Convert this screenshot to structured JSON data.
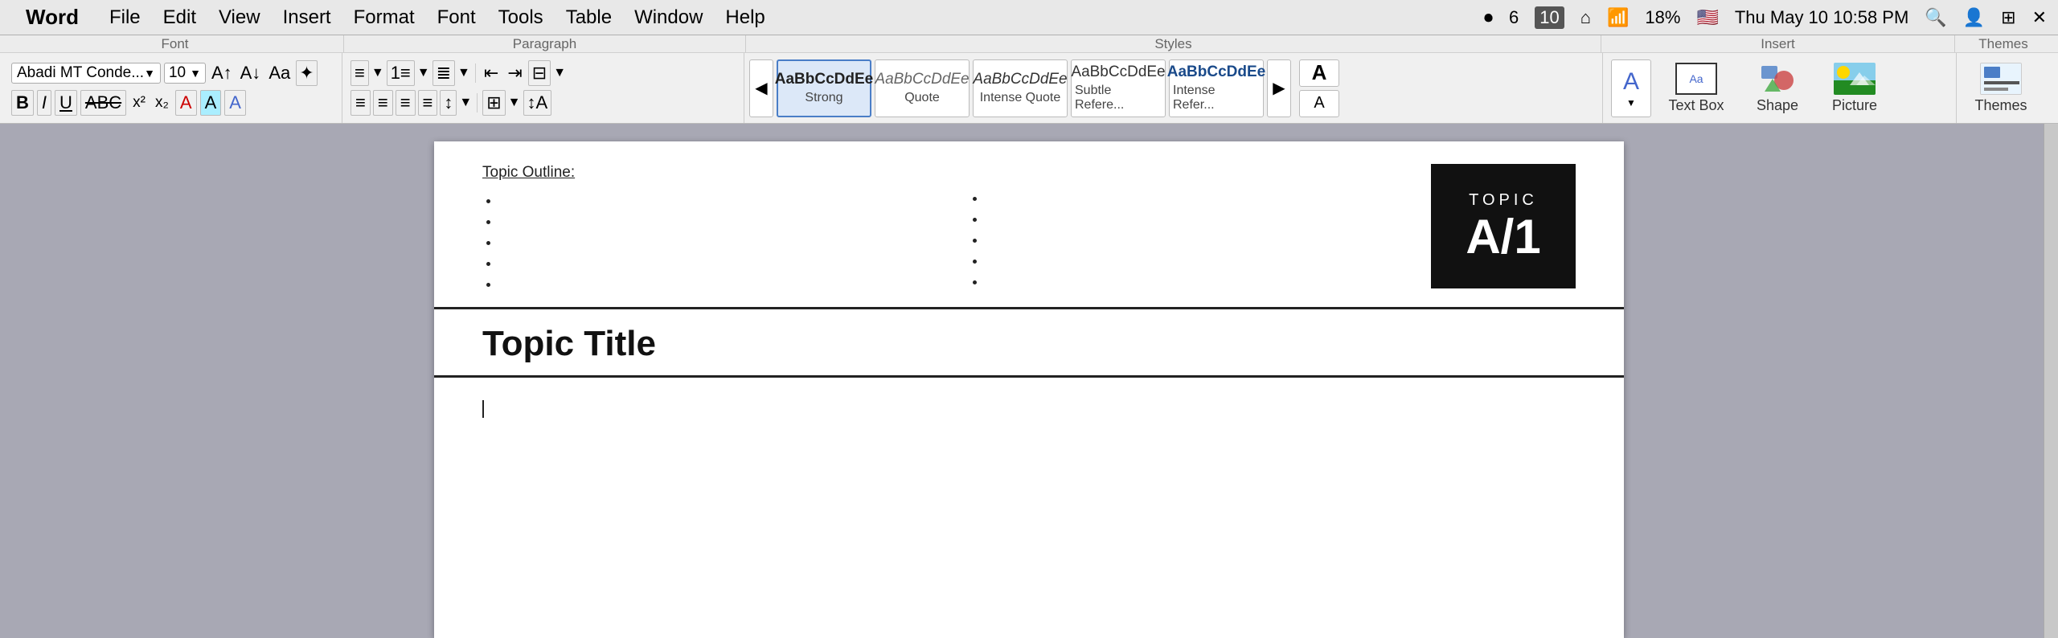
{
  "app": {
    "name": "Word",
    "apple_logo": ""
  },
  "menu_bar": {
    "items": [
      "File",
      "Edit",
      "View",
      "Insert",
      "Format",
      "Font",
      "Tools",
      "Table",
      "Window",
      "Help"
    ],
    "status": {
      "battery": "18%",
      "time": "Thu May 10  10:58 PM",
      "wifi": "WiFi",
      "bluetooth": "BT"
    }
  },
  "toolbar": {
    "section_labels": [
      "Font",
      "Paragraph",
      "Styles",
      "Insert",
      "Themes"
    ],
    "font_name": "Abadi MT Conde...",
    "font_size": "10",
    "styles": [
      {
        "id": "strong",
        "preview_text": "AaBbCcDdEe",
        "label": "Strong",
        "selected": true
      },
      {
        "id": "quote",
        "preview_text": "AaBbCcDdEe",
        "label": "Quote",
        "selected": false
      },
      {
        "id": "intense-quote",
        "preview_text": "AaBbCcDdEe",
        "label": "Intense Quote",
        "selected": false
      },
      {
        "id": "subtle-ref",
        "preview_text": "AaBbCcDdEe",
        "label": "Subtle Refere...",
        "selected": false
      },
      {
        "id": "intense-ref",
        "preview_text": "AaBbCcDdEe",
        "label": "Intense Refer...",
        "selected": false
      }
    ],
    "insert_items": [
      {
        "id": "text-box",
        "label": "Text Box"
      },
      {
        "id": "shape",
        "label": "Shape"
      },
      {
        "id": "picture",
        "label": "Picture"
      },
      {
        "id": "themes",
        "label": "Themes"
      }
    ]
  },
  "document": {
    "outline_label": "Topic Outline:",
    "outline_bullets_col1": [
      "",
      "",
      "",
      "",
      "",
      ""
    ],
    "outline_bullets_col2": [
      "",
      "",
      "",
      "",
      "",
      ""
    ],
    "topic_label": "TOPIC",
    "topic_number": "A/1",
    "page_title": "Topic Title",
    "content": ""
  }
}
